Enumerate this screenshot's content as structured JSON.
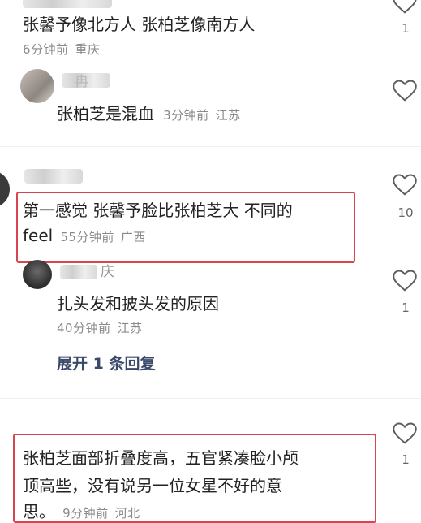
{
  "comments": [
    {
      "id": "c1",
      "text": "张馨予像北方人 张柏芝像南方人",
      "time": "6分钟前",
      "region": "重庆",
      "likes": "1"
    },
    {
      "id": "r1",
      "author_partial": "冉",
      "text": "张柏芝是混血",
      "time": "3分钟前",
      "region": "江苏",
      "likes": ""
    },
    {
      "id": "c2",
      "text_line1": "第一感觉 张馨予脸比张柏芝大 不同的",
      "text_line2": "feel",
      "time": "55分钟前",
      "region": "广西",
      "likes": "10"
    },
    {
      "id": "r2",
      "author_partial": "庆",
      "text": "扎头发和披头发的原因",
      "time": "40分钟前",
      "region": "江苏",
      "likes": "1"
    },
    {
      "id": "c3",
      "text_line1": "张柏芝面部折叠度高，五官紧凑脸小颅",
      "text_line2": "顶高些，没有说另一位女星不好的意",
      "text_line3": "思。",
      "time": "9分钟前",
      "region": "河北",
      "likes": "1"
    }
  ],
  "expand_replies": "展开 1 条回复",
  "colors": {
    "highlight_border": "#d8454f",
    "meta_text": "#8a8a8a",
    "expand_text": "#3b4a6b"
  },
  "icons": [
    "heart-outline-icon"
  ]
}
